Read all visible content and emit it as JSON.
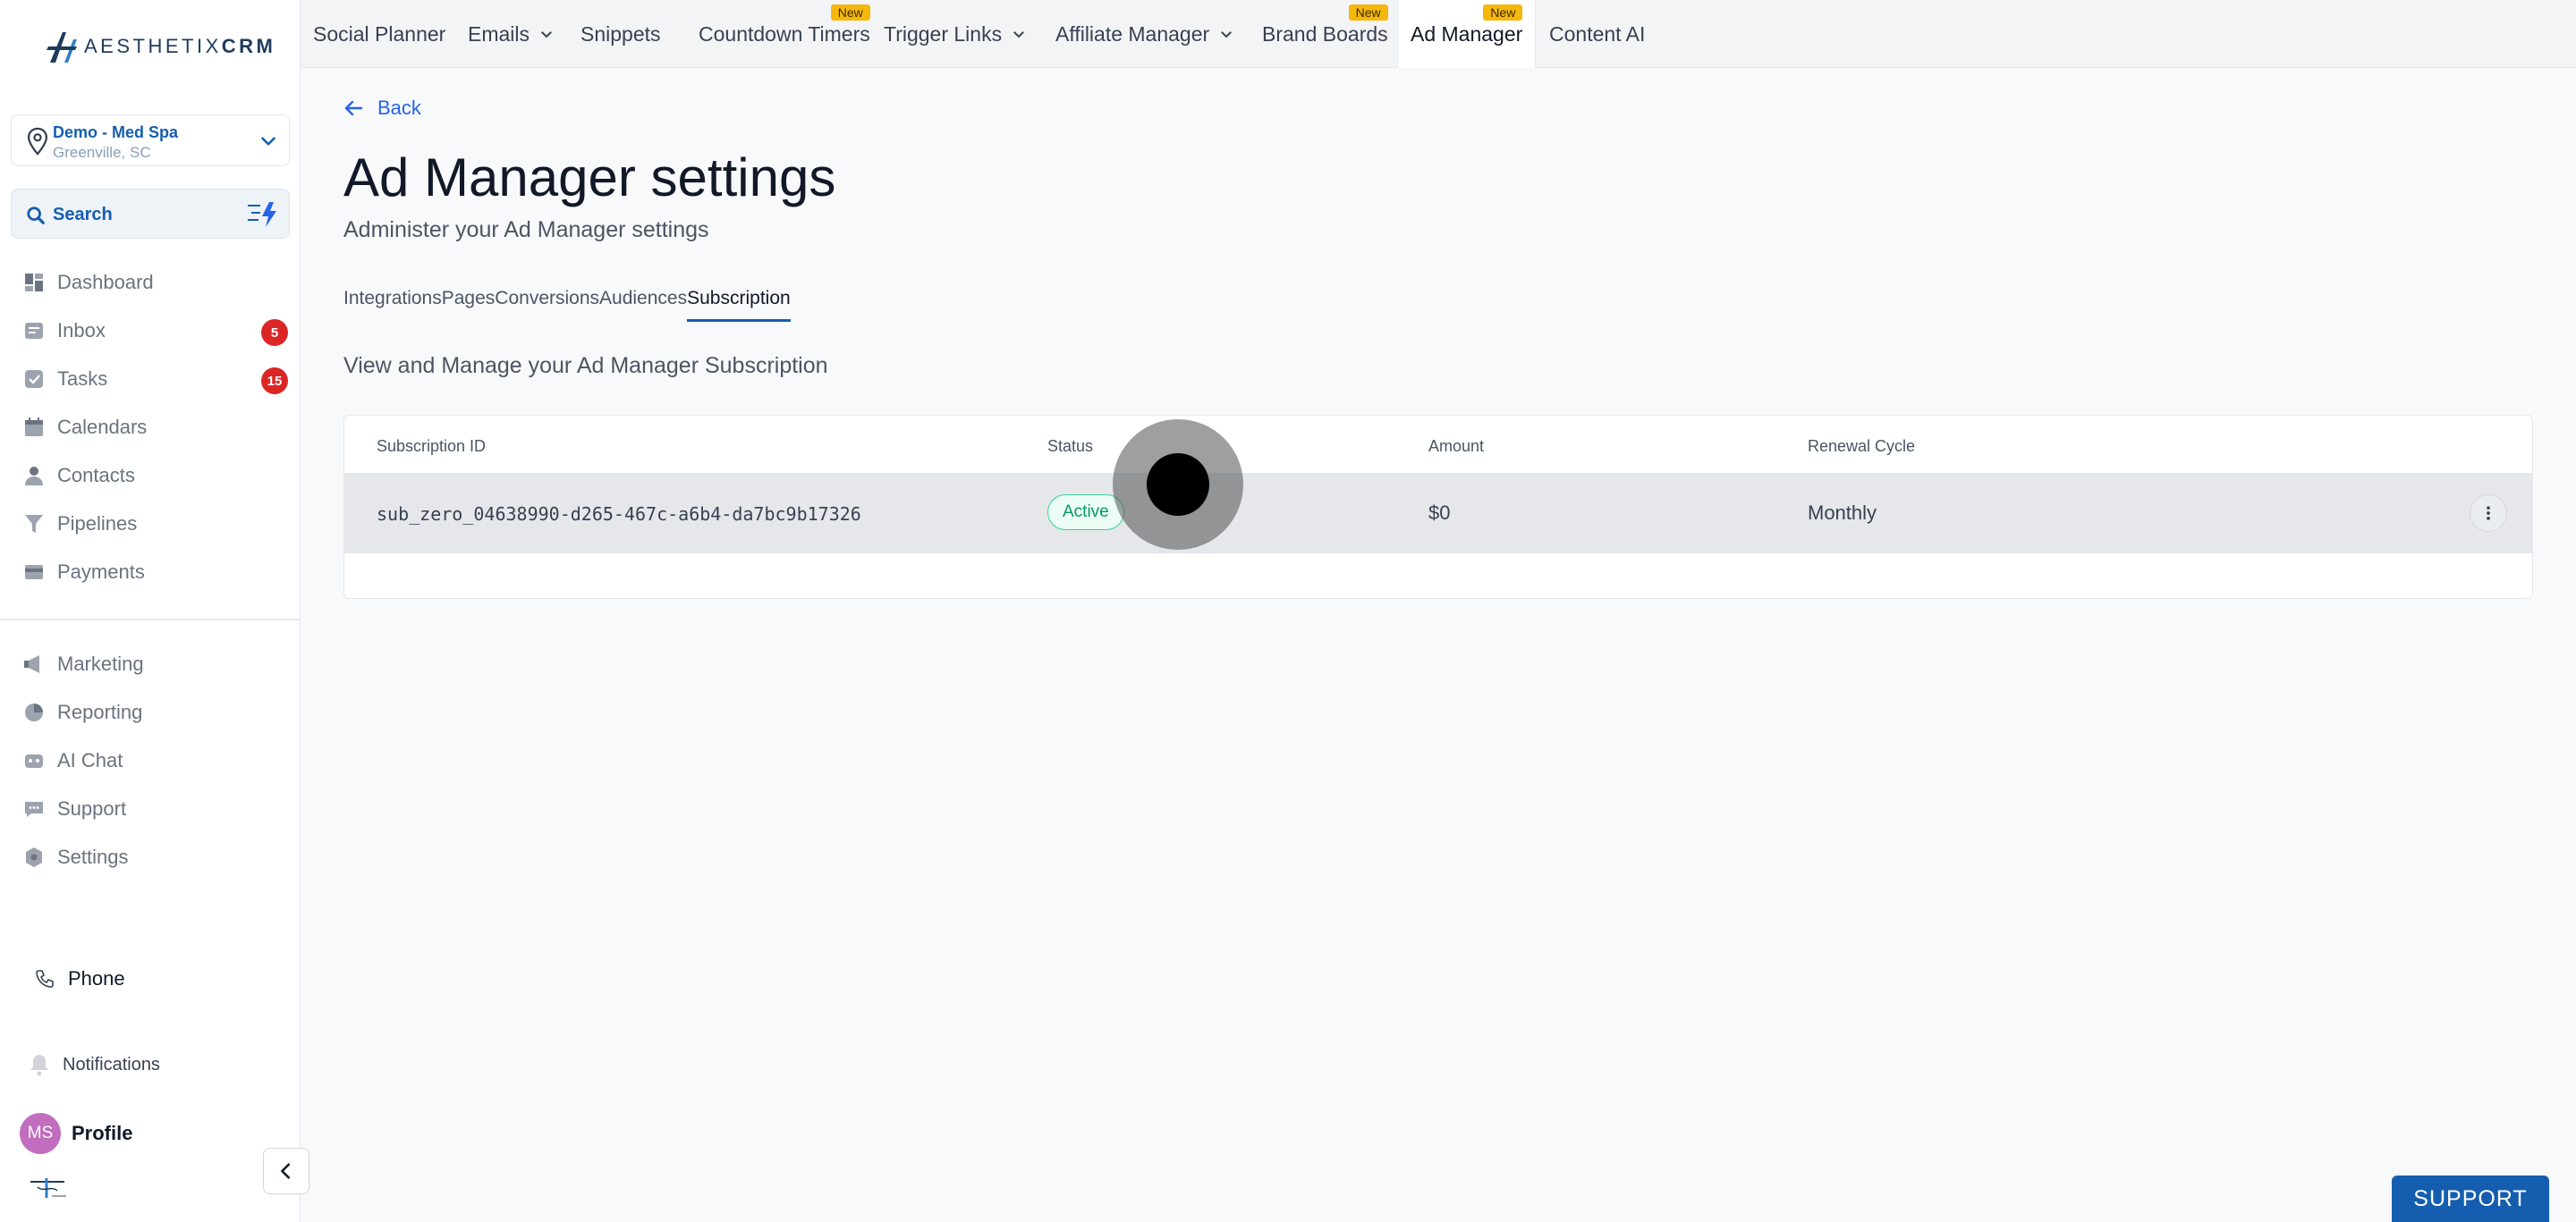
{
  "brand": {
    "logo_text_main": "AESTHETIX",
    "logo_text_accent": "CRM",
    "accent_color": "#155eaf"
  },
  "location": {
    "name": "Demo - Med Spa",
    "city": "Greenville, SC"
  },
  "search": {
    "label": "Search"
  },
  "sidebar": {
    "items": [
      {
        "label": "Dashboard",
        "icon": "dashboard-icon"
      },
      {
        "label": "Inbox",
        "icon": "inbox-icon",
        "badge": "5"
      },
      {
        "label": "Tasks",
        "icon": "tasks-icon",
        "badge": "15"
      },
      {
        "label": "Calendars",
        "icon": "calendar-icon"
      },
      {
        "label": "Contacts",
        "icon": "contacts-icon"
      },
      {
        "label": "Pipelines",
        "icon": "pipelines-icon"
      },
      {
        "label": "Payments",
        "icon": "payments-icon"
      }
    ],
    "items2": [
      {
        "label": "Marketing",
        "icon": "megaphone-icon"
      },
      {
        "label": "Reporting",
        "icon": "pie-chart-icon"
      },
      {
        "label": "AI Chat",
        "icon": "robot-icon"
      },
      {
        "label": "Support",
        "icon": "chat-bubble-icon"
      },
      {
        "label": "Settings",
        "icon": "gear-icon"
      }
    ],
    "phone": "Phone",
    "notifications": "Notifications",
    "profile": {
      "initials": "MS",
      "label": "Profile"
    }
  },
  "topnav": {
    "items": [
      {
        "label": "Social Planner"
      },
      {
        "label": "Emails",
        "dropdown": true
      },
      {
        "label": "Snippets"
      },
      {
        "label": "Countdown Timers",
        "tag": "New"
      },
      {
        "label": "Trigger Links",
        "dropdown": true
      },
      {
        "label": "Affiliate Manager",
        "dropdown": true
      },
      {
        "label": "Brand Boards",
        "tag": "New"
      },
      {
        "label": "Ad Manager",
        "tag": "New",
        "active": true
      },
      {
        "label": "Content AI"
      }
    ]
  },
  "page": {
    "back": "Back",
    "title": "Ad Manager settings",
    "subtitle": "Administer your Ad Manager settings",
    "tabs": [
      "Integrations",
      "Pages",
      "Conversions",
      "Audiences",
      "Subscription"
    ],
    "active_tab": "Subscription",
    "section_title": "View and Manage your Ad Manager Subscription"
  },
  "table": {
    "headers": {
      "id": "Subscription ID",
      "status": "Status",
      "amount": "Amount",
      "cycle": "Renewal Cycle"
    },
    "rows": [
      {
        "id": "sub_zero_04638990-d265-467c-a6b4-da7bc9b17326",
        "status": "Active",
        "amount": "$0",
        "cycle": "Monthly"
      }
    ]
  },
  "support_button": "SUPPORT"
}
